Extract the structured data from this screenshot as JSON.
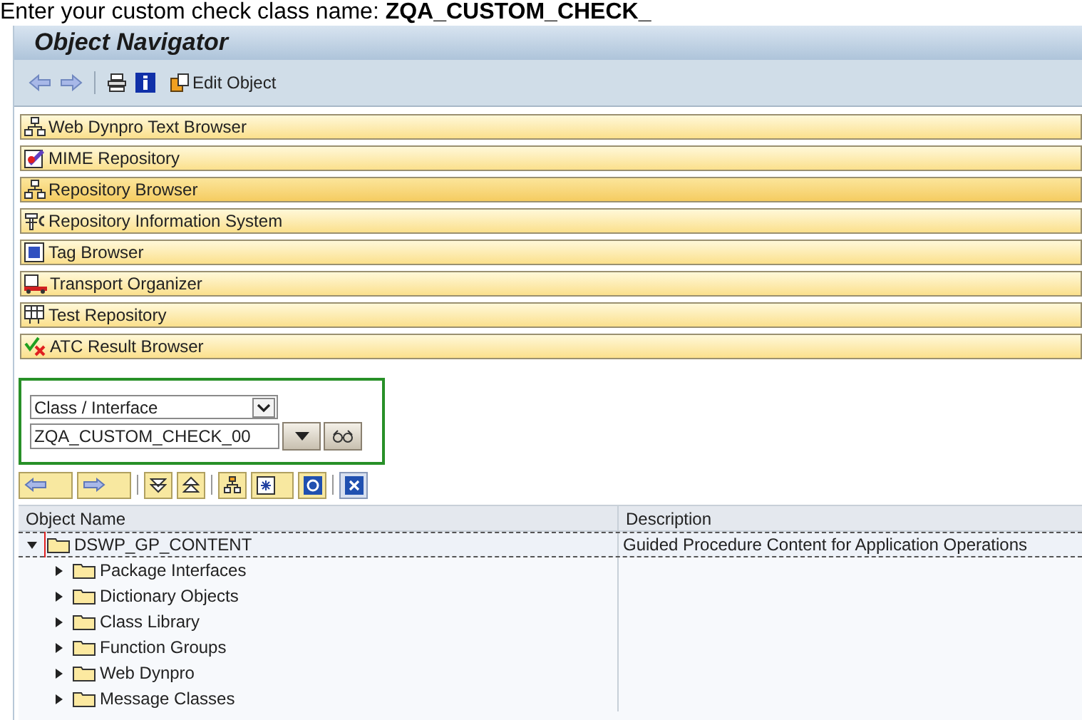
{
  "caption": "Enter your custom check class name: **ZQA_CUSTOM_CHECK_**",
  "window": {
    "title": "Object Navigator"
  },
  "toolbar": {
    "button_label": "Edit Object"
  },
  "browsers": [
    {
      "label": "Web Dynpro Text Browser",
      "selected": false
    },
    {
      "label": "MIME Repository",
      "selected": false
    },
    {
      "label": "Repository Browser",
      "selected": true
    },
    {
      "label": "Repository Information System",
      "selected": false
    },
    {
      "label": "Tag Browser",
      "selected": false
    },
    {
      "label": "Transport Organizer",
      "selected": false
    },
    {
      "label": "Test Repository",
      "selected": false
    },
    {
      "label": "ATC Result Browser",
      "selected": false
    }
  ],
  "object_type": {
    "value": "Class / Interface"
  },
  "object_name": {
    "value": "ZQA_CUSTOM_CHECK_00"
  },
  "table": {
    "columns": [
      "Object Name",
      "Description"
    ],
    "tree": [
      {
        "label": "DSWP_GP_CONTENT",
        "description": "Guided Procedure Content for Application Operations",
        "expanded": true,
        "selected": true,
        "children": [
          {
            "label": "Package Interfaces",
            "expanded": false
          },
          {
            "label": "Dictionary Objects",
            "expanded": false
          },
          {
            "label": "Class Library",
            "expanded": false
          },
          {
            "label": "Function Groups",
            "expanded": false
          },
          {
            "label": "Web Dynpro",
            "expanded": false
          },
          {
            "label": "Message Classes",
            "expanded": false
          }
        ]
      }
    ]
  }
}
